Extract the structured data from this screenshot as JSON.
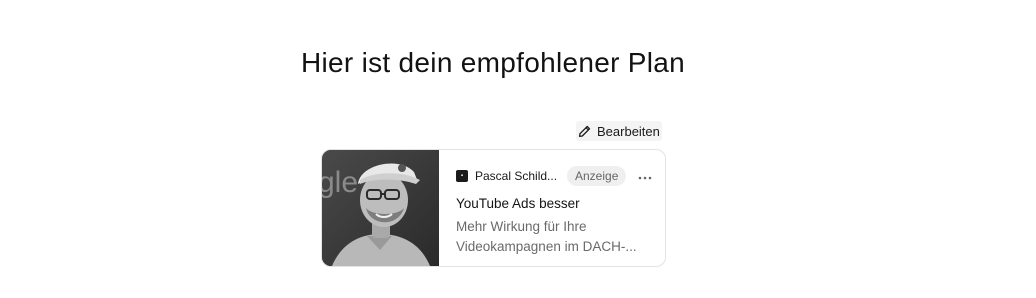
{
  "page": {
    "heading": "Hier ist dein empfohlener Plan"
  },
  "edit": {
    "label": "Bearbeiten",
    "icon": "pencil-icon"
  },
  "ad_card": {
    "advertiser": "Pascal Schild...",
    "badge": "Anzeige",
    "more_icon": "more-horizontal-icon",
    "title": "YouTube Ads besser",
    "description_lines": [
      "Mehr Wirkung für Ihre",
      "Videokampagnen im DACH-..."
    ],
    "image_background_text": "gle"
  },
  "colors": {
    "text": "#121212",
    "muted": "#6a6a6a",
    "badge_bg": "#efefef",
    "card_border": "#e3e3e3"
  }
}
